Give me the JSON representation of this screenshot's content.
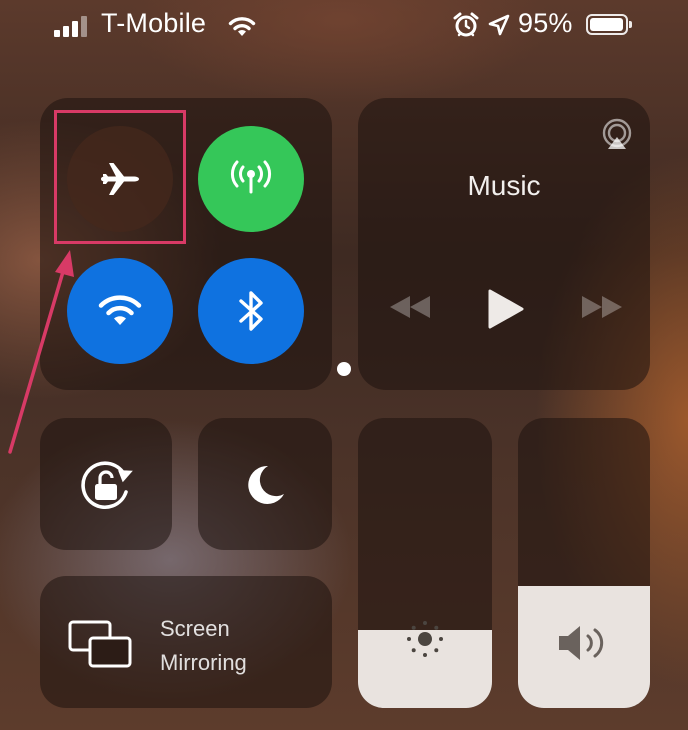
{
  "status_bar": {
    "carrier": "T-Mobile",
    "battery_percent": "95%"
  },
  "music": {
    "title": "Music"
  },
  "screen_mirroring": {
    "line1": "Screen",
    "line2": "Mirroring"
  },
  "sliders": {
    "brightness_level": 0.27,
    "volume_level": 0.42
  },
  "colors": {
    "cellular_green": "#35c759",
    "bluetooth_blue": "#0f72e0",
    "wifi_blue": "#0f72e0",
    "highlight_red": "#d83a66"
  },
  "icons": {
    "airplane": "airplane-icon",
    "cellular": "cellular-antenna-icon",
    "wifi": "wifi-icon",
    "bluetooth": "bluetooth-icon",
    "airplay": "airplay-icon",
    "rewind": "rewind-icon",
    "play": "play-icon",
    "fast_forward": "fast-forward-icon",
    "rotation_lock": "rotation-lock-icon",
    "do_not_disturb": "moon-icon",
    "screen_mirroring": "screen-mirroring-icon",
    "brightness": "sun-icon",
    "volume": "speaker-icon"
  }
}
